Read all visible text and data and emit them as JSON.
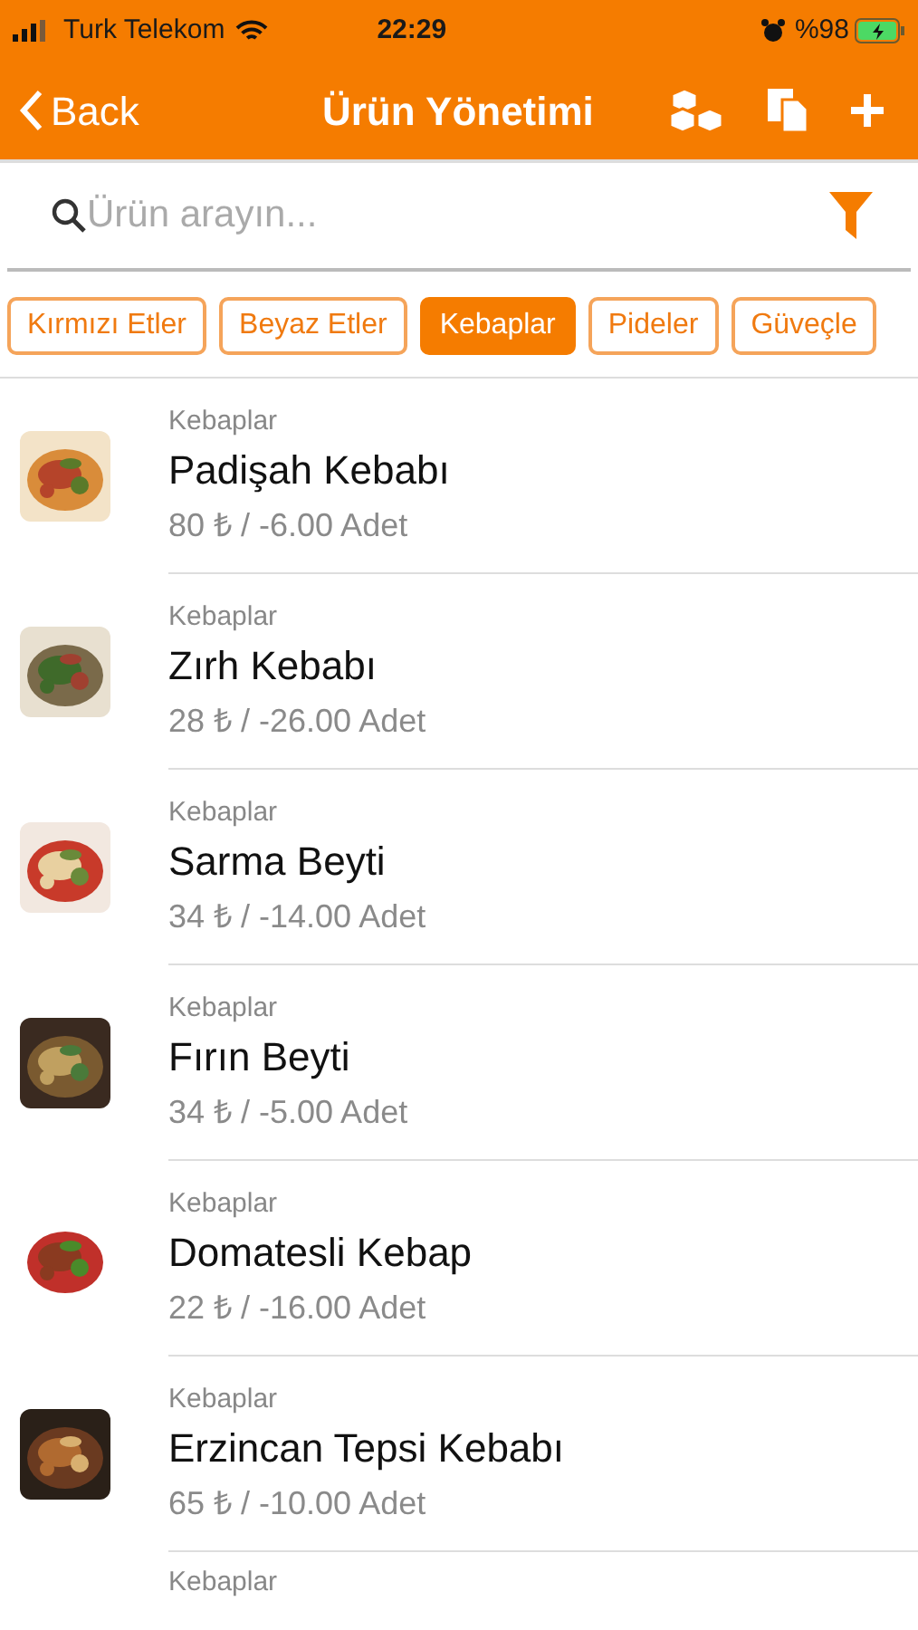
{
  "status_bar": {
    "carrier": "Turk Telekom",
    "time": "22:29",
    "battery": "%98"
  },
  "nav_bar": {
    "back": "Back",
    "title": "Ürün Yönetimi"
  },
  "search": {
    "placeholder": "Ürün arayın..."
  },
  "categories": [
    {
      "label": "Kırmızı Etler",
      "selected": false
    },
    {
      "label": "Beyaz Etler",
      "selected": false
    },
    {
      "label": "Kebaplar",
      "selected": true
    },
    {
      "label": "Pideler",
      "selected": false
    },
    {
      "label": "Güveçle",
      "selected": false
    }
  ],
  "products": [
    {
      "category": "Kebaplar",
      "name": "Padişah Kebabı",
      "details": "80 ₺ / -6.00 Adet",
      "kind": "picture"
    },
    {
      "category": "Kebaplar",
      "name": "Zırh Kebabı",
      "details": "28 ₺ / -26.00 Adet",
      "kind": "picture"
    },
    {
      "category": "Kebaplar",
      "name": "Sarma Beyti",
      "details": "34 ₺ / -14.00 Adet",
      "kind": "picture"
    },
    {
      "category": "Kebaplar",
      "name": "Fırın Beyti",
      "details": "34 ₺ / -5.00 Adet",
      "kind": "picture"
    },
    {
      "category": "Kebaplar",
      "name": "Domatesli Kebap",
      "details": "22 ₺ / -16.00 Adet",
      "kind": "picture"
    },
    {
      "category": "Kebaplar",
      "name": "Erzincan Tepsi Kebabı",
      "details": "65 ₺ / -10.00 Adet",
      "kind": "picture"
    },
    {
      "category": "Kebaplar"
    }
  ]
}
